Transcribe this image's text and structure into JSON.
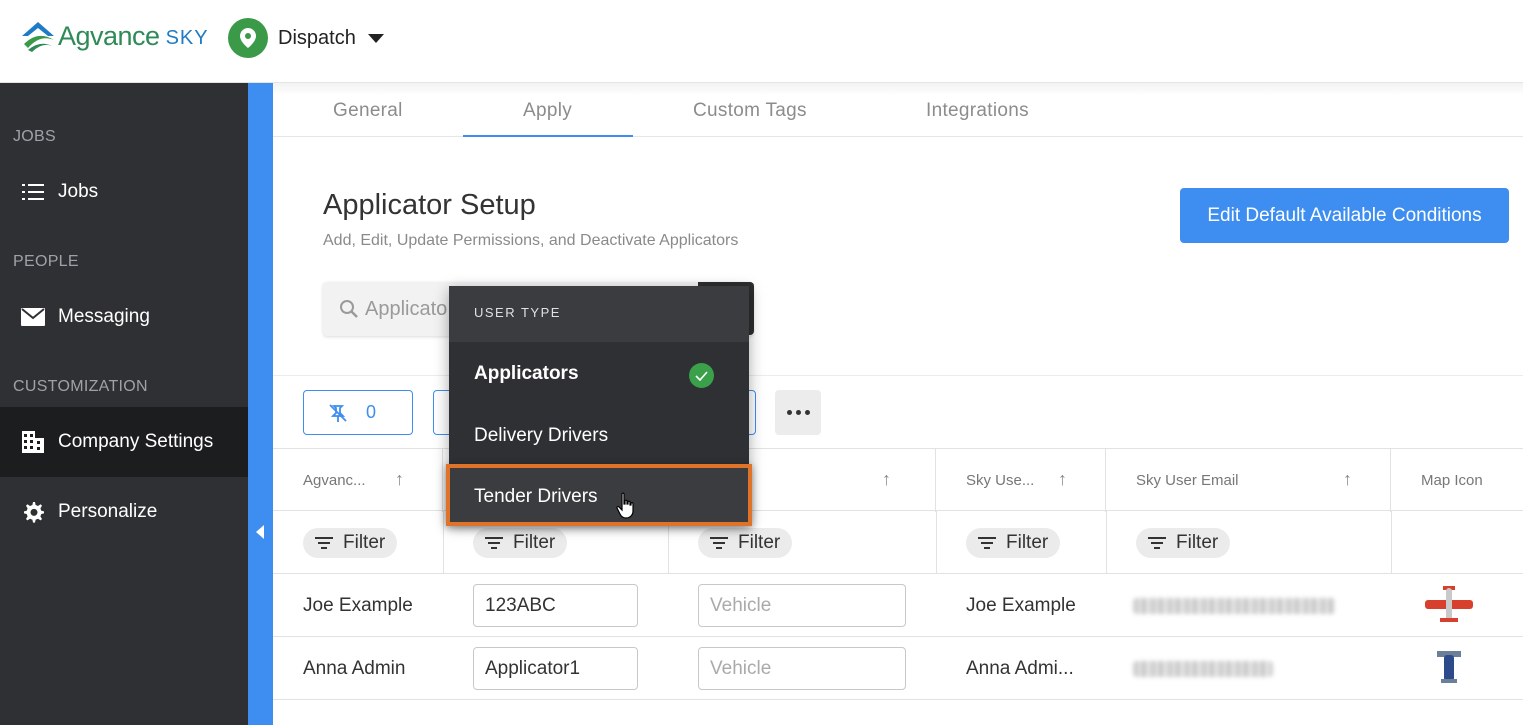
{
  "header": {
    "logo_text": "Agvance",
    "logo_suffix": "SKY",
    "app_name": "Dispatch"
  },
  "sidebar": {
    "sections": [
      {
        "title": "JOBS",
        "items": [
          {
            "label": "Jobs",
            "icon": "list-icon"
          }
        ]
      },
      {
        "title": "PEOPLE",
        "items": [
          {
            "label": "Messaging",
            "icon": "mail-icon"
          }
        ]
      },
      {
        "title": "CUSTOMIZATION",
        "items": [
          {
            "label": "Company Settings",
            "icon": "building-icon",
            "active": true
          },
          {
            "label": "Personalize",
            "icon": "gear-icon"
          }
        ]
      }
    ]
  },
  "tabs": [
    {
      "label": "General"
    },
    {
      "label": "Apply",
      "active": true
    },
    {
      "label": "Custom Tags"
    },
    {
      "label": "Integrations"
    }
  ],
  "page": {
    "title": "Applicator Setup",
    "subtitle": "Add, Edit, Update Permissions, and Deactivate Applicators",
    "edit_button": "Edit Default Available Conditions"
  },
  "search": {
    "placeholder": "Applicato"
  },
  "toolbar": {
    "pin_count": "0"
  },
  "dropdown": {
    "header": "USER TYPE",
    "options": [
      {
        "label": "Applicators",
        "selected": true
      },
      {
        "label": "Delivery Drivers",
        "selected": false
      },
      {
        "label": "Tender Drivers",
        "selected": false,
        "hovered": true
      }
    ]
  },
  "grid": {
    "columns": [
      {
        "label": "Agvanc..."
      },
      {
        "label": ""
      },
      {
        "label": ""
      },
      {
        "label": "Sky Use..."
      },
      {
        "label": "Sky User Email"
      },
      {
        "label": "Map Icon"
      }
    ],
    "filter_label": "Filter",
    "rows": [
      {
        "name": "Joe Example",
        "applicator_id": "123ABC",
        "vehicle_placeholder": "Vehicle",
        "sky_user": "Joe Example",
        "map_icon": "red-plane-icon"
      },
      {
        "name": "Anna Admin",
        "applicator_id": "Applicator1",
        "vehicle_placeholder": "Vehicle",
        "sky_user": "Anna Admi...",
        "map_icon": "blue-plane-icon"
      }
    ]
  },
  "colors": {
    "accent": "#3d8ef0",
    "sidebar_bg": "#2f3033",
    "highlight": "#e0732a",
    "success": "#3aa04a"
  }
}
